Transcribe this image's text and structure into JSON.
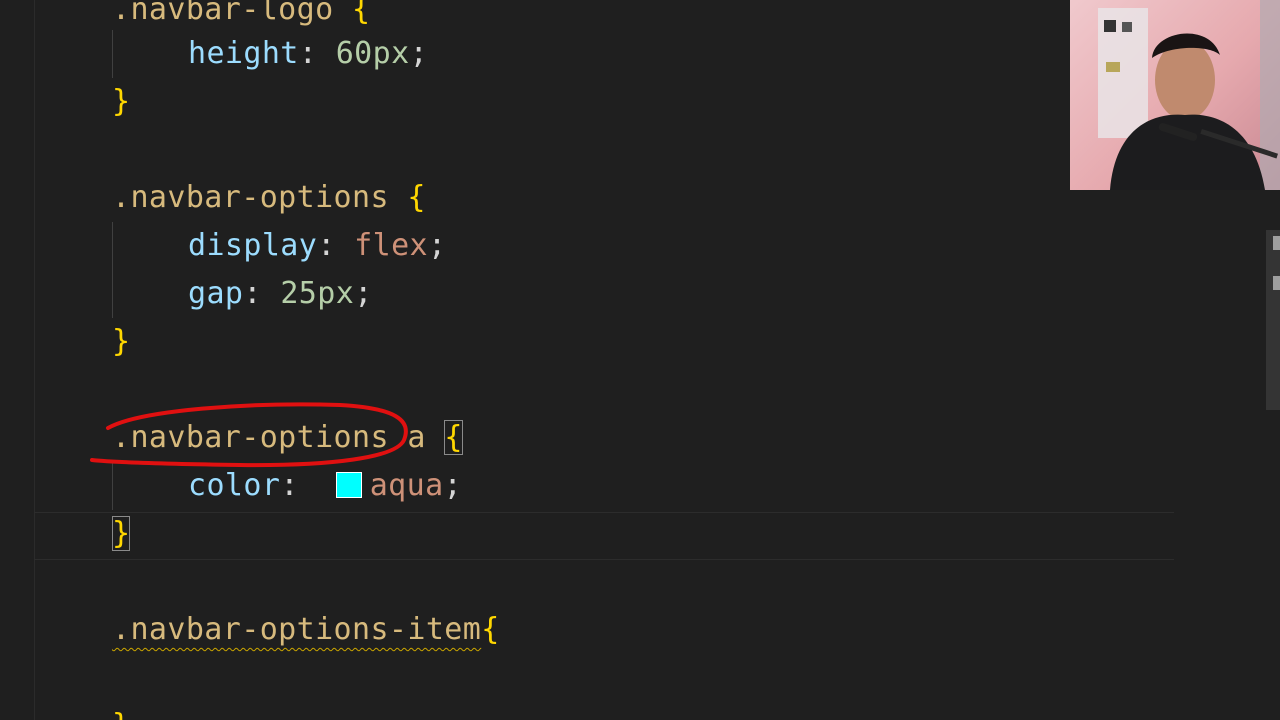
{
  "editor": {
    "blocks": [
      {
        "selector_text": ".navbar-logo",
        "props": [
          {
            "name": "height",
            "value": "60px"
          }
        ]
      },
      {
        "selector_text": ".navbar-options",
        "props": [
          {
            "name": "display",
            "value": "flex"
          },
          {
            "name": "gap",
            "value": "25px"
          }
        ]
      },
      {
        "selector_text": ".navbar-options",
        "descendant": "a",
        "props": [
          {
            "name": "color",
            "value": "aqua",
            "swatch_color": "#00ffff"
          }
        ]
      },
      {
        "selector_text": ".navbar-options-item",
        "props": []
      }
    ],
    "syntax": {
      "open_brace": "{",
      "close_brace": "}",
      "colon": ":",
      "semicolon": ";"
    },
    "colors": {
      "background": "#1f1f1f",
      "selector": "#d7ba7d",
      "property": "#9cdcfe",
      "number": "#b5cea8",
      "keyword_value": "#ce9178",
      "brace": "#ffd700",
      "annotation_stroke": "#e01010"
    }
  },
  "overlay": {
    "webcam_icon": "person-webcam-icon"
  }
}
